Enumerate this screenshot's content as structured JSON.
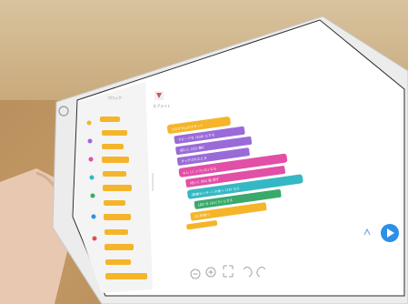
{
  "scene": {
    "palette": {
      "table": "#b8895a",
      "tablet_body": "#e9e9e9",
      "screen_bg": "#ffffff",
      "sidebar_bg": "#f3f3f3",
      "block_yellow": "#f5b52a",
      "block_purple": "#9a6bd8",
      "block_pink": "#e24fa7",
      "block_teal": "#35b8c4",
      "block_green": "#3aa96b",
      "run_button": "#2d8fe6"
    },
    "app": {
      "sidebar_header": "ブロック",
      "stage_label": "スプライト",
      "blocks": [
        {
          "label": "プログラムがスタート",
          "color": "block_yellow"
        },
        {
          "label": "スピードを (100) にする",
          "color": "block_purple"
        },
        {
          "label": "(前) に (10) 進む",
          "color": "block_purple"
        },
        {
          "label": "タッチされたとき",
          "color": "block_purple"
        },
        {
          "label": "もし (くっついた) なら",
          "color": "block_pink"
        },
        {
          "label": "(右) に (90) 度 回す",
          "color": "block_pink"
        },
        {
          "label": "(距離センサー) の値 > (10) なら",
          "color": "block_teal"
        },
        {
          "label": "LED を (みどり) にする",
          "color": "block_green"
        },
        {
          "label": "(1) 秒待つ",
          "color": "block_yellow"
        }
      ],
      "bottom_toolbar": [
        "zoom-out",
        "zoom-in",
        "fit",
        "undo",
        "redo"
      ]
    }
  }
}
